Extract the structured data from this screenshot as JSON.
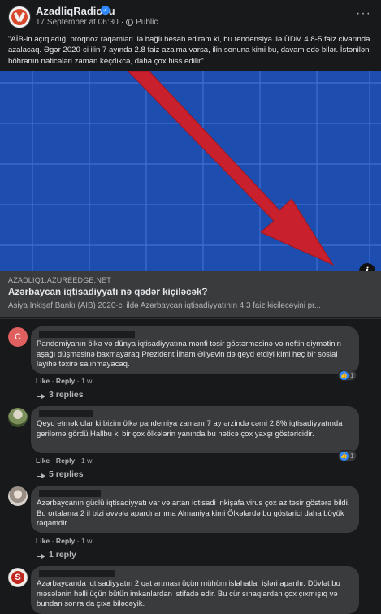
{
  "post": {
    "page_name": "AzadliqRadiosu",
    "date": "17 September at 06:30",
    "separator": "·",
    "privacy": "Public",
    "more": "···",
    "text": "\"AİB-in açıqladığı proqnoz rəqəmləri ilə bağlı hesab edirəm ki, bu tendensiya ilə ÜDM 4.8-5 faiz civarında azalacaq. Əgər 2020-ci ilin 7 ayında 2.8 faiz azalma varsa, ilin sonuna kimi bu, davam edə bilər. İstənilən böhranın nəticələri zaman keçdikcə, daha çox hiss edilir\"."
  },
  "link": {
    "domain": "AZADLIQ1.AZUREEDGE.NET",
    "title": "Azərbaycan iqtisadiyyatı nə qədər kiçiləcək?",
    "description": "Asiya İnkişaf Bankı (AİB) 2020-ci ildə Azərbaycan iqtisadiyyatının 4.3 faiz kiçiləcəyini pr...",
    "info": "i"
  },
  "colors": {
    "background": "#18191a",
    "bubble": "#3a3b3c",
    "accent": "#2d88ff",
    "chart_blue": "#1d4aa8",
    "arrow_red": "#c8202c"
  },
  "comments": [
    {
      "avatar_letter": "C",
      "text": "Pandemiyanın ölkə və dünya iqtisadiyyatına mənfi təsir göstərməsinə və neftin qiymətinin aşağı düşməsinə baxmayaraq Prezident İlham Əliyevin də qeyd etdiyi kimi heç bir sosial layihə təxirə salınmayacaq.",
      "like": "Like",
      "dot": "·",
      "reply": "Reply",
      "time": "1 w",
      "reactions": "1",
      "replies": "3 replies"
    },
    {
      "text": "Qeyd etmək olar ki,bizim ölkə pandemiya zamanı 7 ay ərzində cəmi 2,8% iqtisadiyyatında geriləmə gördü.Hallbu ki bir çox ölkələrin yanında bu nəticə çox yaxşı göstəricidir.",
      "like": "Like",
      "dot": "·",
      "reply": "Reply",
      "time": "1 w",
      "reactions": "1",
      "replies": "5 replies"
    },
    {
      "text": "Azərbaycanın güclü iqtisadiyyatı var və artan iqtisadi inkişafa virus çox az təsir göstərə bildi. Bu ortalama 2 il bizi əvvələ apardı amma Almaniya kimi Ölkələrdə bu göstərici daha böyük rəqəmdir.",
      "like": "Like",
      "dot": "·",
      "reply": "Reply",
      "time": "1 w",
      "replies": "1 reply"
    },
    {
      "avatar_letter": "S",
      "text": "Azərbaycanda iqtisadiyyatın 2 qat artması üçün mühüm islahatlar işləri aparılır. Dövlət bu məsələnin həlli üçün bütün imkanlardan istifadə edir. Bu cür sınaqlardan çox çıxmışıq və bundan sonra da çıxa biləcəyik."
    }
  ]
}
